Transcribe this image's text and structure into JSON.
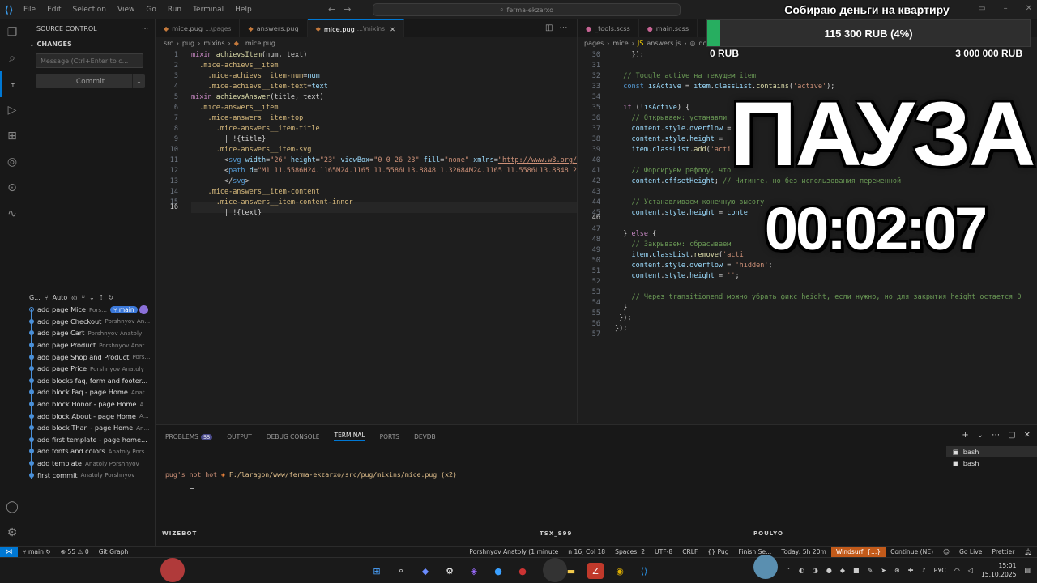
{
  "titlebar": {
    "menus": [
      "File",
      "Edit",
      "Selection",
      "View",
      "Go",
      "Run",
      "Terminal",
      "Help"
    ],
    "search": "ferma-ekzarxo"
  },
  "sidebar": {
    "title": "SOURCE CONTROL",
    "changes": "CHANGES",
    "message_placeholder": "Message (Ctrl+Enter to c...",
    "commit": "Commit",
    "graph_label": "G...",
    "graph_auto": "Auto",
    "commits": [
      {
        "msg": "add page Mice",
        "author": "Pors...",
        "badge": "main"
      },
      {
        "msg": "add page Checkout",
        "author": "Porshnyov An..."
      },
      {
        "msg": "add page Cart",
        "author": "Porshnyov Anatoly"
      },
      {
        "msg": "add page Product",
        "author": "Porshnyov Anat..."
      },
      {
        "msg": "add page Shop and Product",
        "author": "Pors..."
      },
      {
        "msg": "add page Price",
        "author": "Porshnyov Anatoly"
      },
      {
        "msg": "add blocks faq, form and footer...",
        "author": ""
      },
      {
        "msg": "add block Faq - page Home",
        "author": "Anat..."
      },
      {
        "msg": "add block Honor - page Home",
        "author": "A..."
      },
      {
        "msg": "add block About - page Home",
        "author": "A..."
      },
      {
        "msg": "add block Than - page Home",
        "author": "An..."
      },
      {
        "msg": "add first template - page home...",
        "author": ""
      },
      {
        "msg": "add fonts and colors",
        "author": "Anatoly Pors..."
      },
      {
        "msg": "add template",
        "author": "Anatoly Porshnyov"
      },
      {
        "msg": "first commit",
        "author": "Anatoly Porshnyov"
      }
    ]
  },
  "left_editor": {
    "tabs": [
      {
        "name": "mice.pug",
        "dim": "...\\pages"
      },
      {
        "name": "answers.pug",
        "dim": ""
      },
      {
        "name": "mice.pug",
        "dim": "...\\mixins",
        "active": true
      }
    ],
    "breadcrumb": [
      "src",
      "pug",
      "mixins",
      "mice.pug"
    ],
    "line_numbers": [
      "1",
      "2",
      "3",
      "4",
      "5",
      "6",
      "7",
      "8",
      "9",
      "10",
      "11",
      "12",
      "13",
      "14",
      "15",
      "16"
    ]
  },
  "right_editor": {
    "tabs": [
      {
        "name": "_tools.scss"
      },
      {
        "name": "main.scss"
      }
    ],
    "breadcrumb": [
      "pages",
      "mice",
      "answers.js",
      "doc"
    ],
    "line_numbers": [
      "30",
      "31",
      "32",
      "33",
      "34",
      "35",
      "36",
      "37",
      "38",
      "39",
      "40",
      "41",
      "42",
      "43",
      "44",
      "45",
      "46",
      "47",
      "48",
      "49",
      "50",
      "51",
      "52",
      "53",
      "54",
      "55",
      "56",
      "57"
    ]
  },
  "panel": {
    "tabs": [
      "PROBLEMS",
      "OUTPUT",
      "DEBUG CONSOLE",
      "TERMINAL",
      "PORTS",
      "DEVDB"
    ],
    "problems_count": "55",
    "terminal_line1_a": "pug's not hot",
    "terminal_line1_path": "F:/laragon/www/ferma-ekzarxo/src/pug/mixins/mice.pug",
    "terminal_line1_note": "(x2)",
    "terminals": [
      "bash",
      "bash"
    ],
    "captions": [
      "WIZEBOT",
      "TSX_999",
      "POULYO"
    ]
  },
  "statusbar": {
    "branch": "main",
    "errors": "55",
    "warnings": "0",
    "git_graph": "Git Graph",
    "blame": "Porshnyov Anatoly (1 minute",
    "cursor": "n 16, Col 18",
    "spaces": "Spaces: 2",
    "encoding": "UTF-8",
    "eol": "CRLF",
    "lang": "Pug",
    "finish": "Finish Se...",
    "today": "Today: 5h 20m",
    "windsurf": "Windsurf: {...}",
    "continue": "Continue (NE)",
    "golive": "Go Live",
    "prettier": "Prettier"
  },
  "taskbar": {
    "lang": "РУС",
    "time": "15:01",
    "date": "15.10.2025"
  },
  "overlay": {
    "donate_title": "Собираю деньги на квартиру",
    "amount": "115 300 RUB (4%)",
    "progress": 0.04,
    "min": "0 RUB",
    "max": "3 000 000 RUB",
    "pause": "ПАУЗА",
    "timer": "00:02:07"
  },
  "colors": {
    "accent": "#0078d4",
    "progress": "#27ae60",
    "windsurf": "#c25a1a"
  }
}
